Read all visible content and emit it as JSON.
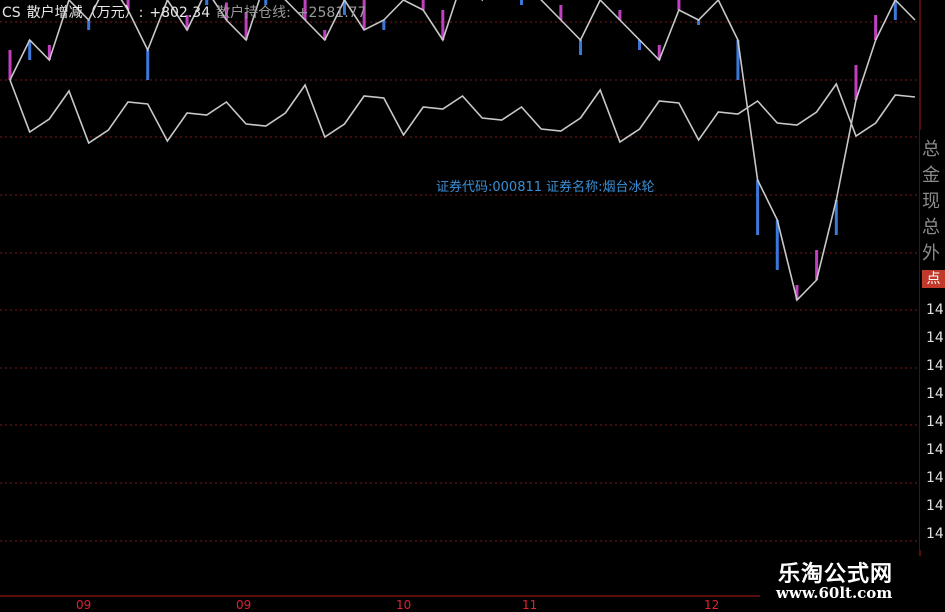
{
  "header": {
    "indicator": "CS",
    "label1": "散户增减（万元）:",
    "value1": "+802.34",
    "label2": "散户持仓线:",
    "value2": "+2581.77"
  },
  "infobar": "证券代码:000811 证券名称:烟台冰轮",
  "right_panel": {
    "vertical_text": [
      "总",
      "金",
      "现",
      "总",
      "外"
    ],
    "badge": "点",
    "ticks": [
      "14",
      "14",
      "14",
      "14",
      "14",
      "14",
      "14",
      "14",
      "14"
    ]
  },
  "x_ticks": [
    "09",
    "09",
    "10",
    "11",
    "12"
  ],
  "watermark": {
    "text": "乐淘公式网",
    "url": "www.60lt.com"
  },
  "colors": {
    "line": "#c8c8c8",
    "pos": "#c040c0",
    "neg": "#3b78d8",
    "grid": "#7a1a1a",
    "axis": "#b01818"
  },
  "chart_data": {
    "type": "line",
    "title": "",
    "series": [
      {
        "name": "散户持仓线",
        "values": [
          2520,
          2560,
          2540,
          2600,
          2580,
          2620,
          2590,
          2550,
          2600,
          2570,
          2610,
          2580,
          2560,
          2620,
          2600,
          2580,
          2560,
          2600,
          2570,
          2580,
          2600,
          2590,
          2560,
          2620,
          2600,
          2640,
          2620,
          2600,
          2580,
          2560,
          2600,
          2580,
          2560,
          2540,
          2590,
          2580,
          2600,
          2560,
          2420,
          2380,
          2300,
          2320,
          2400,
          2500,
          2560,
          2600,
          2580
        ]
      },
      {
        "name": "散户增减（万元）",
        "values": [
          120,
          -80,
          60,
          100,
          -40,
          80,
          140,
          -120,
          90,
          60,
          -60,
          70,
          110,
          -100,
          50,
          120,
          40,
          -60,
          160,
          -40,
          80,
          60,
          120,
          -80,
          100,
          60,
          -100,
          120,
          60,
          -60,
          80,
          40,
          -40,
          60,
          80,
          -20,
          100,
          -160,
          -220,
          -200,
          60,
          120,
          -140,
          140,
          100,
          -80,
          802
        ]
      }
    ]
  }
}
